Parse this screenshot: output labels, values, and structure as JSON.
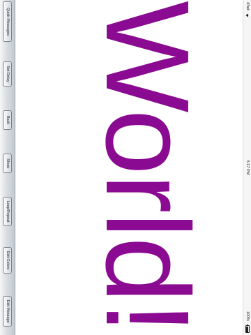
{
  "toolbar": {
    "buttons": [
      {
        "label": "Quick Messages"
      },
      {
        "label": "Set Delay"
      },
      {
        "label": "Back"
      },
      {
        "label": "Show"
      },
      {
        "label": "Loop/Repeat"
      },
      {
        "label": "Edit Colors"
      },
      {
        "label": "Edit Message"
      }
    ]
  },
  "status_bar": {
    "carrier": "iPad",
    "time": "5:17 PM",
    "battery": "100%",
    "wifi_icon": "wifi-icon",
    "battery_icon": "battery-icon"
  },
  "display": {
    "message": "World!",
    "text_color": "#8a0a92",
    "background_color": "#ffffff"
  }
}
